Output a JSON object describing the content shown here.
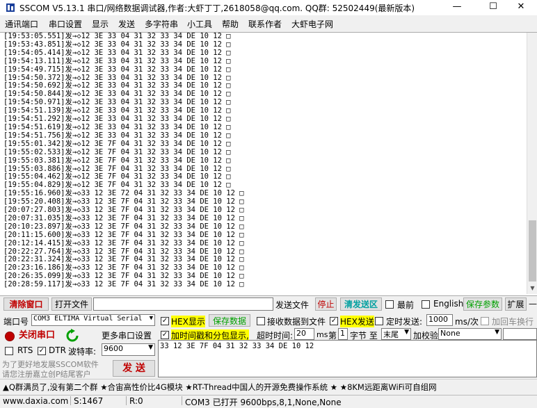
{
  "window": {
    "title": "SSCOM V5.13.1 串口/网络数据调试器,作者:大虾丁丁,2618058@qq.com. QQ群: 52502449(最新版本)",
    "minimize": "—",
    "maximize": "☐",
    "close": "✕"
  },
  "menu": [
    "通讯端口",
    "串口设置",
    "显示",
    "发送",
    "多字符串",
    "小工具",
    "帮助",
    "联系作者",
    "大虾电子网"
  ],
  "log": [
    "[19:53:05.551]发→◇12 3E 33 04 31 32 33 34 DE 10 12 □",
    "[19:53:43.851]发→◇12 3E 33 04 31 32 33 34 DE 10 12 □",
    "[19:54:05.414]发→◇12 3E 33 04 31 32 33 34 DE 10 12 □",
    "[19:54:13.111]发→◇12 3E 33 04 31 32 33 34 DE 10 12 □",
    "[19:54:49.715]发→◇12 3E 33 04 31 32 33 34 DE 10 12 □",
    "[19:54:50.372]发→◇12 3E 33 04 31 32 33 34 DE 10 12 □",
    "[19:54:50.692]发→◇12 3E 33 04 31 32 33 34 DE 10 12 □",
    "[19:54:50.844]发→◇12 3E 33 04 31 32 33 34 DE 10 12 □",
    "[19:54:50.971]发→◇12 3E 33 04 31 32 33 34 DE 10 12 □",
    "[19:54:51.139]发→◇12 3E 33 04 31 32 33 34 DE 10 12 □",
    "[19:54:51.292]发→◇12 3E 33 04 31 32 33 34 DE 10 12 □",
    "[19:54:51.619]发→◇12 3E 33 04 31 32 33 34 DE 10 12 □",
    "[19:54:51.756]发→◇12 3E 33 04 31 32 33 34 DE 10 12 □",
    "[19:55:01.342]发→◇12 3E 7F 04 31 32 33 34 DE 10 12 □",
    "[19:55:02.533]发→◇12 3E 7F 04 31 32 33 34 DE 10 12 □",
    "[19:55:03.381]发→◇12 3E 7F 04 31 32 33 34 DE 10 12 □",
    "[19:55:03.886]发→◇12 3E 7F 04 31 32 33 34 DE 10 12 □",
    "[19:55:04.462]发→◇12 3E 7F 04 31 32 33 34 DE 10 12 □",
    "[19:55:04.829]发→◇12 3E 7F 04 31 32 33 34 DE 10 12 □",
    "[19:55:16.960]发→◇33 12 3E 72 04 31 32 33 34 DE 10 12 □",
    "[19:55:20.408]发→◇33 12 3E 7F 04 31 32 33 34 DE 10 12 □",
    "[20:07:27.803]发→◇33 12 3E 7F 04 31 32 33 34 DE 10 12 □",
    "[20:07:31.035]发→◇33 12 3E 7F 04 31 32 33 34 DE 10 12 □",
    "[20:10:23.897]发→◇33 12 3E 7F 04 31 32 33 34 DE 10 12 □",
    "[20:11:15.600]发→◇33 12 3E 7F 04 31 32 33 34 DE 10 12 □",
    "[20:12:14.415]发→◇33 12 3E 7F 04 31 32 33 34 DE 10 12 □",
    "[20:22:27.764]发→◇33 12 3E 7F 04 31 32 33 34 DE 10 12 □",
    "[20:22:31.324]发→◇33 12 3E 7F 04 31 32 33 34 DE 10 12 □",
    "[20:23:16.186]发→◇33 12 3E 7F 04 31 32 33 34 DE 10 12 □",
    "[20:26:35.099]发→◇33 12 3E 7F 04 31 32 33 34 DE 10 12 □",
    "[20:28:59.117]发→◇33 12 3E 7F 04 31 32 33 34 DE 10 12 □"
  ],
  "toolbar": {
    "clear_window": "清除窗口",
    "open_file": "打开文件",
    "file_path": "",
    "send_file": "发送文件",
    "stop": "停止",
    "clear_send": "清发送区",
    "topmost": "最前",
    "english": "English",
    "save_params": "保存参数",
    "expand": "扩展",
    "collapse": "—"
  },
  "port": {
    "label": "端口号",
    "value": "COM3 ELTIMA Virtual Serial",
    "close_port": "关闭串口",
    "more_settings": "更多串口设置",
    "rts": "RTS",
    "dtr": "DTR",
    "baud_label": "波特率:",
    "baud_value": "9600",
    "promo_line1": "为了更好地发展SSCOM软件",
    "promo_line2": "请您注册嘉立创P结尾客户",
    "send": "发 送"
  },
  "options": {
    "hex_display": "HEX显示",
    "save_data": "保存数据",
    "recv_to_file": "接收数据到文件",
    "hex_send": "HEX发送",
    "timed_send": "定时发送:",
    "interval": "1000",
    "interval_unit": "ms/次",
    "add_crlf": "加回车换行",
    "timestamp": "加时间戳和分包显示,",
    "timeout_label": "超时时间:",
    "timeout_value": "20",
    "timeout_unit": "ms",
    "byte_label_1": "第",
    "byte_index": "1",
    "byte_label_2": "字节 至",
    "byte_end": "末尾",
    "checksum_label": "加校验",
    "checksum_value": "None"
  },
  "send_content": "33 12 3E 7F 04 31 32 33 34 DE 10 12",
  "marquee": "▲Q群满员了,没有第二个群  ★合宙高性价比4G模块  ★RT-Thread中国人的开源免费操作系统  ★  ★8KM远距离WiFi可自组网",
  "status": {
    "site": "www.daxia.com",
    "sent": "S:1467",
    "received": "R:0",
    "port_status": "COM3 已打开  9600bps,8,1,None,None"
  },
  "colors": {
    "accent_green": "#00a000",
    "accent_red": "#c00000",
    "highlight_yellow": "#ffff00"
  }
}
